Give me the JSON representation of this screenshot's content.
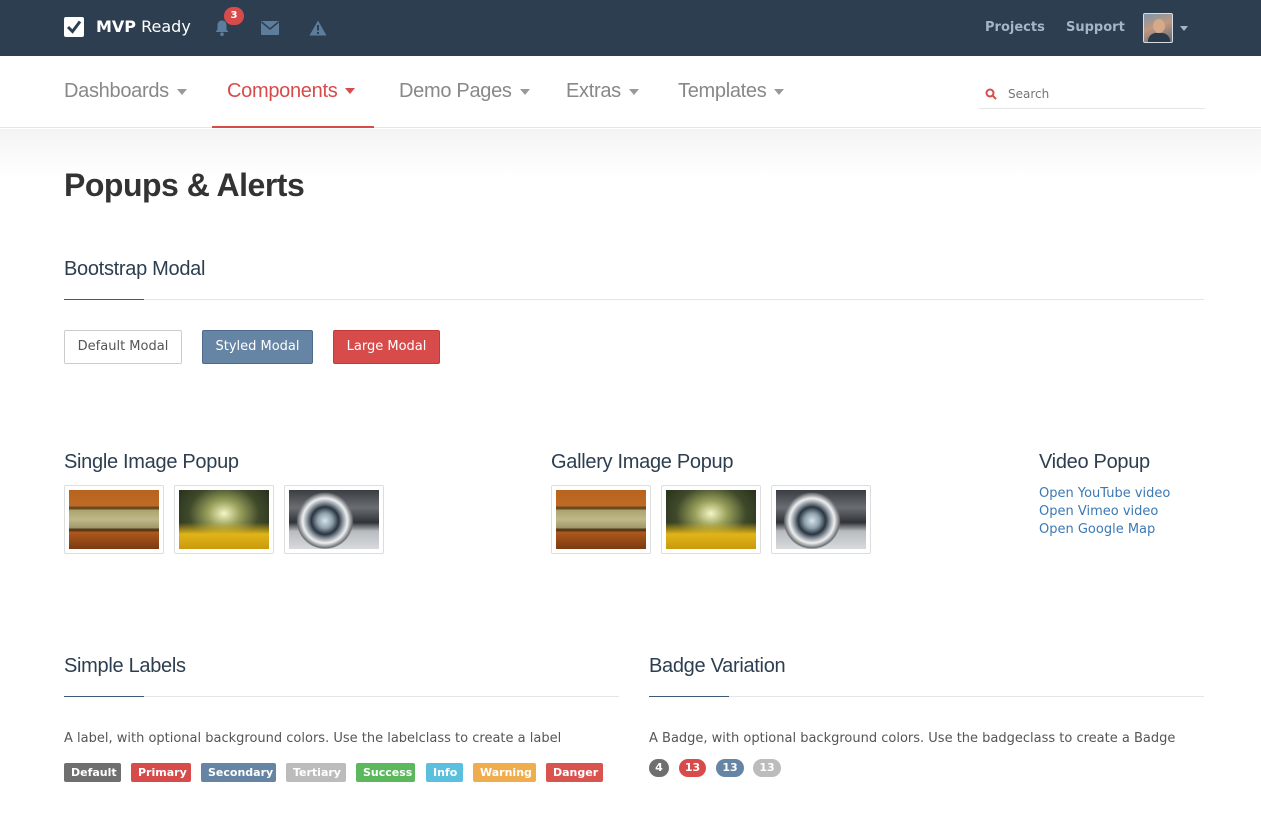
{
  "topbar": {
    "brand_bold": "MVP",
    "brand_light": "Ready",
    "notification_count": "3",
    "links": [
      "Projects",
      "Support"
    ]
  },
  "nav": {
    "items": [
      "Dashboards",
      "Components",
      "Demo Pages",
      "Extras",
      "Templates"
    ],
    "active": "Components",
    "search_placeholder": "Search"
  },
  "page": {
    "title": "Popups & Alerts"
  },
  "modal_section": {
    "title": "Bootstrap Modal",
    "buttons": [
      "Default Modal",
      "Styled Modal",
      "Large Modal"
    ]
  },
  "single_popup": {
    "title": "Single Image Popup"
  },
  "gallery_popup": {
    "title": "Gallery Image Popup"
  },
  "video_popup": {
    "title": "Video Popup",
    "links": [
      "Open YouTube video",
      "Open Vimeo video",
      "Open Google Map"
    ]
  },
  "labels_section": {
    "title": "Simple Labels",
    "description": "A label, with optional background colors. Use the labelclass to create a label",
    "labels": [
      {
        "text": "Default",
        "color": "#6f6f6f"
      },
      {
        "text": "Primary",
        "color": "#d74b4b"
      },
      {
        "text": "Secondary",
        "color": "#6685a4"
      },
      {
        "text": "Tertiary",
        "color": "#bcbcbc"
      },
      {
        "text": "Success",
        "color": "#5cb85c"
      },
      {
        "text": "Info",
        "color": "#5bc0de"
      },
      {
        "text": "Warning",
        "color": "#f0ad4e"
      },
      {
        "text": "Danger",
        "color": "#d9534f"
      }
    ]
  },
  "badges_section": {
    "title": "Badge Variation",
    "description": "A Badge, with optional background colors. Use the badgeclass to create a Badge",
    "badges": [
      {
        "text": "4",
        "color": "#6f6f6f"
      },
      {
        "text": "13",
        "color": "#d74b4b"
      },
      {
        "text": "13",
        "color": "#6685a4"
      },
      {
        "text": "13",
        "color": "#bcbcbc"
      }
    ]
  },
  "colors": {
    "topbar": "#2c3e50",
    "accent": "#d74b4b",
    "link": "#3c78b4"
  }
}
